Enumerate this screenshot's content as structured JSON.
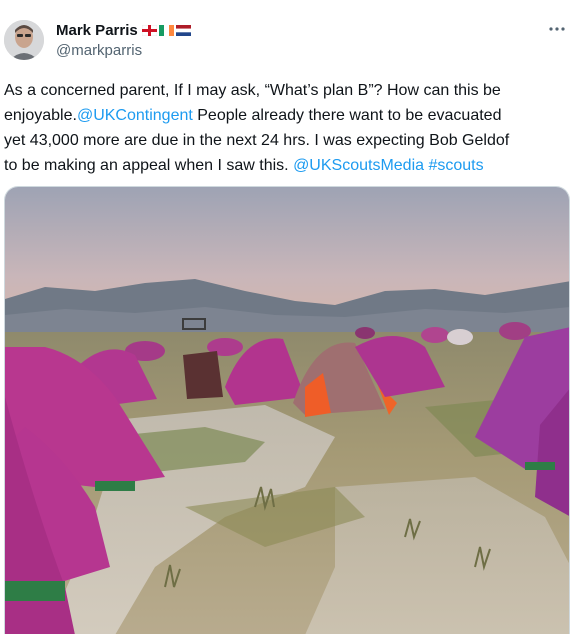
{
  "author": {
    "display_name": "Mark Parris",
    "handle": "@markparris",
    "flags": [
      "england-flag-icon",
      "ireland-flag-icon",
      "netherlands-flag-icon"
    ]
  },
  "tweet": {
    "line1": "As a concerned parent, If I may ask, “What’s plan B”?  How can this be",
    "line2_prefix": "enjoyable.",
    "line2_mention": "@UKContingent",
    "line2_suffix": " People already there want to be evacuated",
    "line3": "yet 43,000 more are due in the next 24 hrs.  I was expecting Bob Geldof",
    "line4_prefix": "to be making an appeal when I saw this. ",
    "line4_mention": "@UKScoutsMedia",
    "line4_space": " ",
    "line4_hashtag": "#scouts"
  },
  "media": {
    "description_icon": "photo-flooded-campsite"
  },
  "colors": {
    "link": "#1d9bf0",
    "secondary_text": "#536471",
    "tent": "#b2338f"
  }
}
